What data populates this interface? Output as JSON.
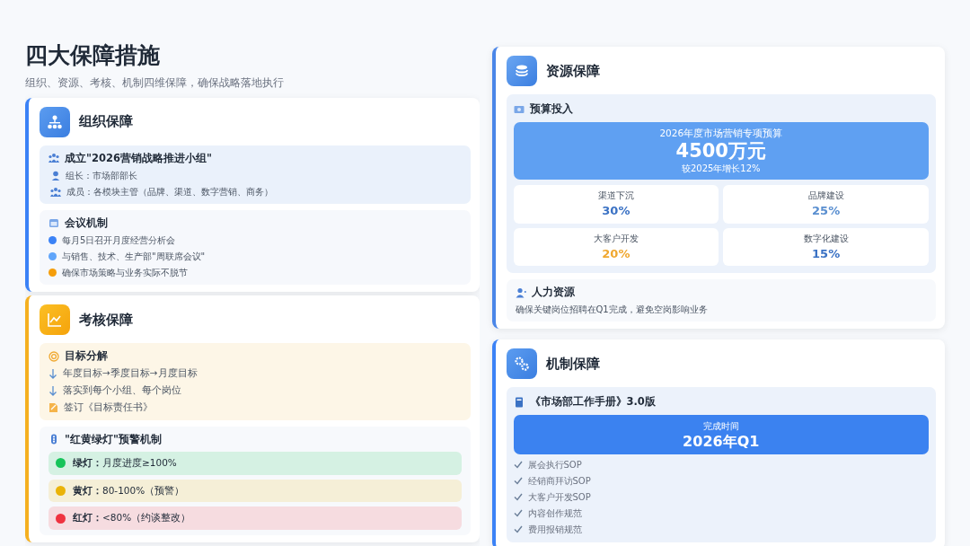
{
  "header": {
    "title": "四大保障措施",
    "subtitle": "组织、资源、考核、机制四维保障，确保战略落地执行"
  },
  "organization": {
    "title": "组织保障",
    "team": {
      "title": "成立\"2026营销战略推进小组\"",
      "rows": [
        {
          "kind": "leader",
          "text": "组长：市场部部长"
        },
        {
          "kind": "members",
          "text": "成员：各模块主管（品牌、渠道、数字营销、商务）"
        }
      ]
    },
    "meeting": {
      "title": "会议机制",
      "items": [
        {
          "text": "每月5日召开月度经营分析会",
          "color": "#3b82f6"
        },
        {
          "text": "与销售、技术、生产部\"周联席会议\"",
          "color": "#60a5fa"
        },
        {
          "text": "确保市场策略与业务实际不脱节",
          "color": "#f59e0b"
        }
      ]
    }
  },
  "assessment": {
    "title": "考核保障",
    "goals": {
      "title": "目标分解",
      "items": [
        {
          "kind": "arrow",
          "text": "年度目标→季度目标→月度目标"
        },
        {
          "kind": "arrow",
          "text": "落实到每个小组、每个岗位"
        },
        {
          "kind": "sign",
          "text": "签订《目标责任书》"
        }
      ]
    },
    "alerts": {
      "title": "\"红黄绿灯\"预警机制",
      "lights": [
        {
          "text": "**绿灯：**月度进度≥100%",
          "color": "#16c45a"
        },
        {
          "text": "**黄灯：**80-100%（预警）",
          "color": "#eab308"
        },
        {
          "text": "**红灯：**<80%（约谈整改）",
          "color": "#ef3340"
        }
      ]
    }
  },
  "resources": {
    "title": "资源保障",
    "budget": {
      "title": "预算投入",
      "banner": {
        "caption": "2026年度市场营销专项预算",
        "amount": "4500万元",
        "note": "较2025年增长12%"
      },
      "allocations": [
        {
          "label": "渠道下沉",
          "value": "30%",
          "color": "#3b72c4"
        },
        {
          "label": "品牌建设",
          "value": "25%",
          "color": "#5a8fd0"
        },
        {
          "label": "大客户开发",
          "value": "20%",
          "color": "#f0a830"
        },
        {
          "label": "数字化建设",
          "value": "15%",
          "color": "#3b72c4"
        }
      ]
    },
    "hr": {
      "title": "人力资源",
      "text": "确保关键岗位招聘在Q1完成，避免空岗影响业务"
    }
  },
  "mechanism": {
    "title": "机制保障",
    "manual": {
      "title": "《市场部工作手册》3.0版",
      "banner": {
        "caption": "完成时间",
        "value": "2026年Q1"
      },
      "checklist": [
        {
          "text": "展会执行SOP"
        },
        {
          "text": "经销商拜访SOP"
        },
        {
          "text": "大客户开发SOP"
        },
        {
          "text": "内容创作规范"
        },
        {
          "text": "费用报销规范"
        }
      ]
    }
  }
}
